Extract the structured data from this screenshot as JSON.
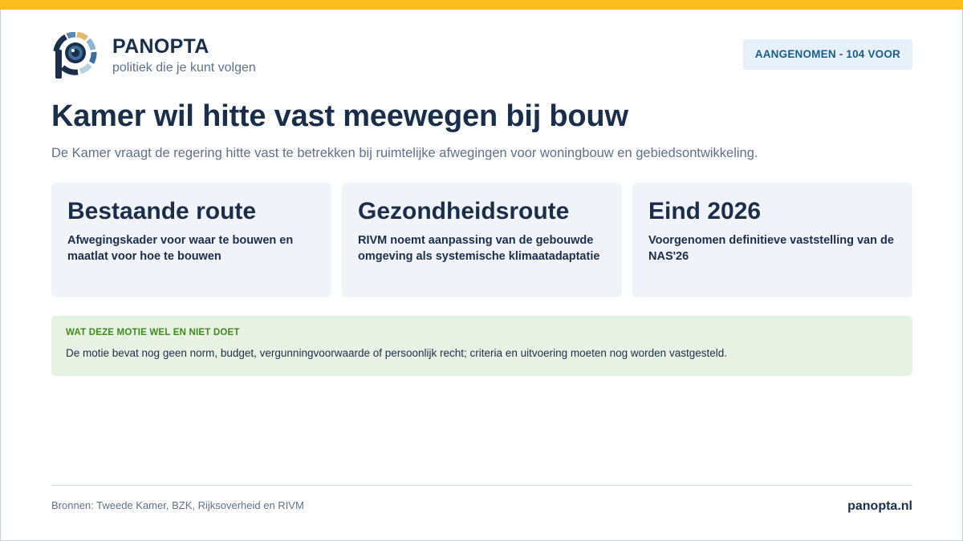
{
  "brand": {
    "name": "PANOPTA",
    "tagline": "politiek die je kunt volgen",
    "logo_icon": "panopta-eye-logo-icon"
  },
  "status": {
    "label": "AANGENOMEN - 104 VOOR"
  },
  "headline": {
    "title": "Kamer wil hitte vast meewegen bij bouw",
    "subtitle": "De Kamer vraagt de regering hitte vast te betrekken bij ruimtelijke afwegingen voor woningbouw en gebiedsontwikkeling."
  },
  "cards": [
    {
      "title": "Bestaande route",
      "text": "Afwegingskader voor waar te bouwen en maatlat voor hoe te bouwen"
    },
    {
      "title": "Gezondheidsroute",
      "text": "RIVM noemt aanpassing van de gebouwde omgeving als systemische klimaatadaptatie"
    },
    {
      "title": "Eind 2026",
      "text": "Voorgenomen definitieve vaststelling van de NAS'26"
    }
  ],
  "note": {
    "label": "WAT DEZE MOTIE WEL EN NIET DOET",
    "text": "De motie bevat nog geen norm, budget, vergunningvoorwaarde of persoonlijk recht; criteria en uitvoering moeten nog worden vastgesteld."
  },
  "footer": {
    "sources": "Bronnen: Tweede Kamer, BZK, Rijksoverheid en RIVM",
    "site": "panopta.nl"
  },
  "colors": {
    "accent_bar": "#fbbc1e",
    "navy": "#1a2e4a",
    "badge_bg": "#e6f0f8",
    "badge_text": "#1a5c87",
    "card_bg": "#f0f4f8",
    "note_bg": "#e8f2e2",
    "note_label": "#3d8a1c"
  }
}
